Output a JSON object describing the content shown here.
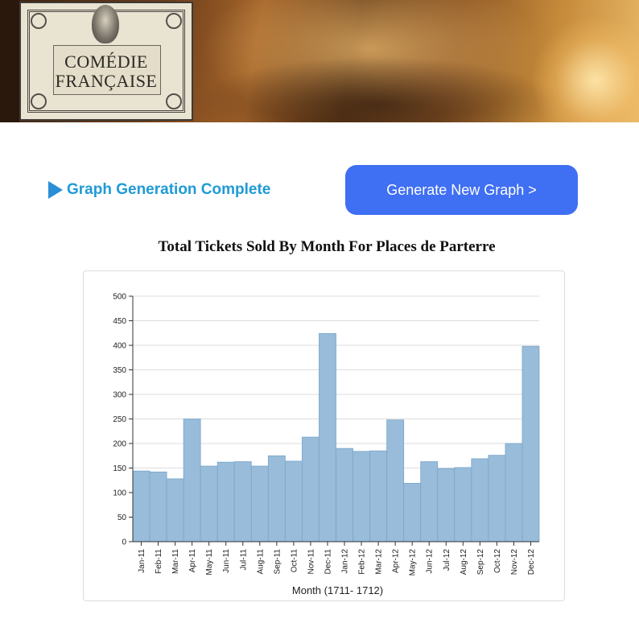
{
  "header": {
    "logo_line1": "COMÉDIE",
    "logo_line2": "FRANÇAISE"
  },
  "status": {
    "text": "Graph Generation Complete",
    "icon": "play-triangle-icon",
    "color": "#1f9ad6"
  },
  "actions": {
    "generate_label": "Generate New Graph >",
    "generate_color": "#3f6ff2"
  },
  "chart_data": {
    "type": "bar",
    "title": "Total Tickets Sold By Month For Places de Parterre",
    "xlabel": "Month (1711- 1712)",
    "ylabel": "",
    "ylim": [
      0,
      500
    ],
    "yticks": [
      0,
      50,
      100,
      150,
      200,
      250,
      300,
      350,
      400,
      450,
      500
    ],
    "grid": true,
    "bar_color": "#98bcd9",
    "categories": [
      "Jan-11",
      "Feb-11",
      "Mar-11",
      "Apr-11",
      "May-11",
      "Jun-11",
      "Jul-11",
      "Aug-11",
      "Sep-11",
      "Oct-11",
      "Nov-11",
      "Dec-11",
      "Jan-12",
      "Feb-12",
      "Mar-12",
      "Apr-12",
      "May-12",
      "Jun-12",
      "Jul-12",
      "Aug-12",
      "Sep-12",
      "Oct-12",
      "Nov-12",
      "Dec-12"
    ],
    "values": [
      144,
      142,
      128,
      250,
      154,
      162,
      163,
      154,
      175,
      164,
      213,
      424,
      190,
      184,
      185,
      248,
      119,
      163,
      149,
      151,
      169,
      176,
      200,
      398
    ]
  }
}
